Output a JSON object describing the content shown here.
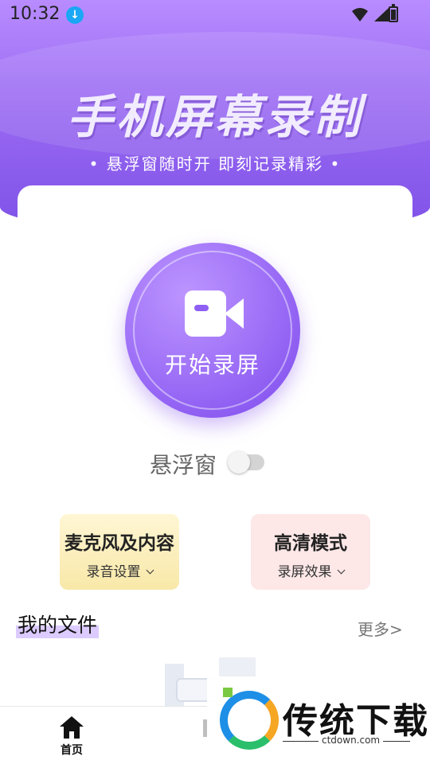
{
  "status_bar": {
    "time": "10:32"
  },
  "hero": {
    "title": "手机屏幕录制",
    "subtitle": "• 悬浮窗随时开  即刻记录精彩 •"
  },
  "record": {
    "label": "开始录屏"
  },
  "float_window": {
    "label": "悬浮窗",
    "enabled": false
  },
  "features": [
    {
      "title": "麦克风及内容",
      "subtitle": "录音设置"
    },
    {
      "title": "高清模式",
      "subtitle": "录屏效果"
    }
  ],
  "files": {
    "title": "我的文件",
    "more": "更多>"
  },
  "tab_bar": {
    "items": [
      {
        "label": "首页"
      }
    ]
  },
  "watermark": {
    "title": "传统下载",
    "url": "ctdown.com"
  },
  "colors": {
    "accent": "#8e5ff3",
    "mic_card": "#f8e8a8",
    "hd_card": "#fde7e7"
  }
}
